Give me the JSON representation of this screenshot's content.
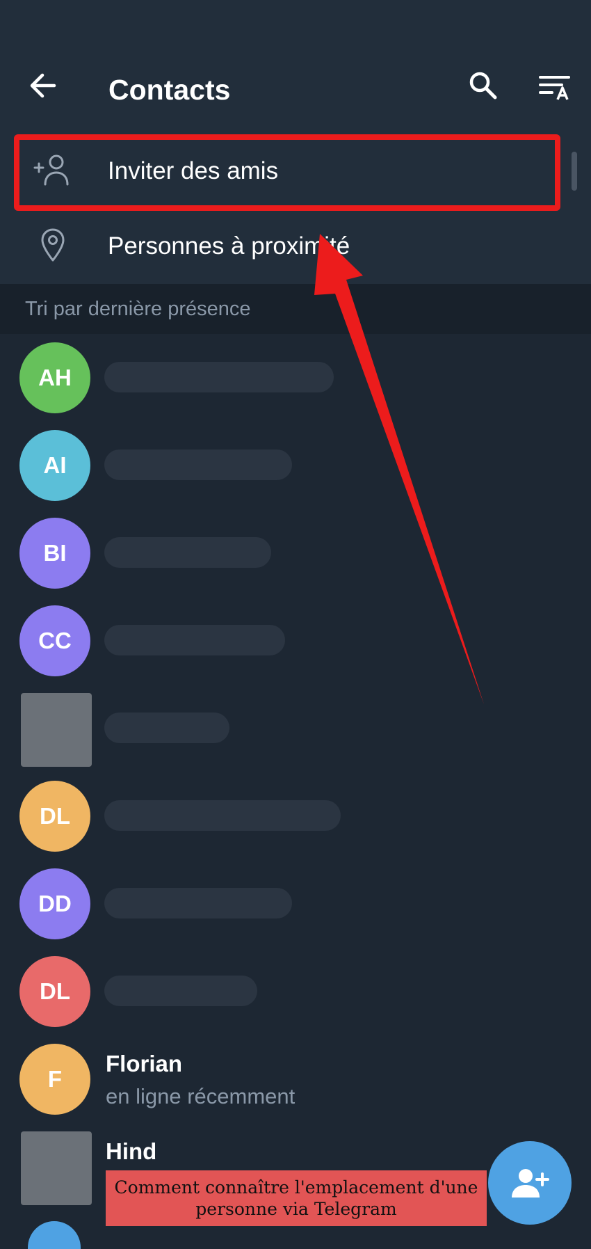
{
  "toolbar": {
    "title": "Contacts",
    "back_icon": "arrow-left-icon",
    "search_icon": "search-icon",
    "sort_icon": "sort-alpha-icon"
  },
  "actions": [
    {
      "label": "Inviter des amis",
      "icon": "add-person-icon"
    },
    {
      "label": "Personnes à proximité",
      "icon": "location-pin-icon"
    }
  ],
  "section_header": "Tri par dernière présence",
  "contacts": [
    {
      "initials": "AH",
      "color": "#66c15b",
      "name": "",
      "status": ""
    },
    {
      "initials": "AI",
      "color": "#5bbfd8",
      "name": "",
      "status": ""
    },
    {
      "initials": "BI",
      "color": "#8c7cf0",
      "name": "",
      "status": ""
    },
    {
      "initials": "CC",
      "color": "#8c7cf0",
      "name": "",
      "status": ""
    },
    {
      "initials": "",
      "color": "#6b7178",
      "name": "",
      "status": ""
    },
    {
      "initials": "DL",
      "color": "#f0b663",
      "name": "",
      "status": ""
    },
    {
      "initials": "DD",
      "color": "#8c7cf0",
      "name": "",
      "status": ""
    },
    {
      "initials": "DL",
      "color": "#e86a6a",
      "name": "",
      "status": ""
    },
    {
      "initials": "F",
      "color": "#f0b663",
      "name": "Florian",
      "status": "en ligne récemment"
    },
    {
      "initials": "",
      "color": "#6b7178",
      "name": "Hind",
      "status": ""
    }
  ],
  "fab": {
    "icon": "add-contact-icon"
  },
  "caption": "Comment connaître l'emplacement d'une personne via Telegram",
  "colors": {
    "background": "#1d2733",
    "header": "#222e3b",
    "highlight": "#ec1c1c",
    "fab": "#4fa2e3"
  }
}
